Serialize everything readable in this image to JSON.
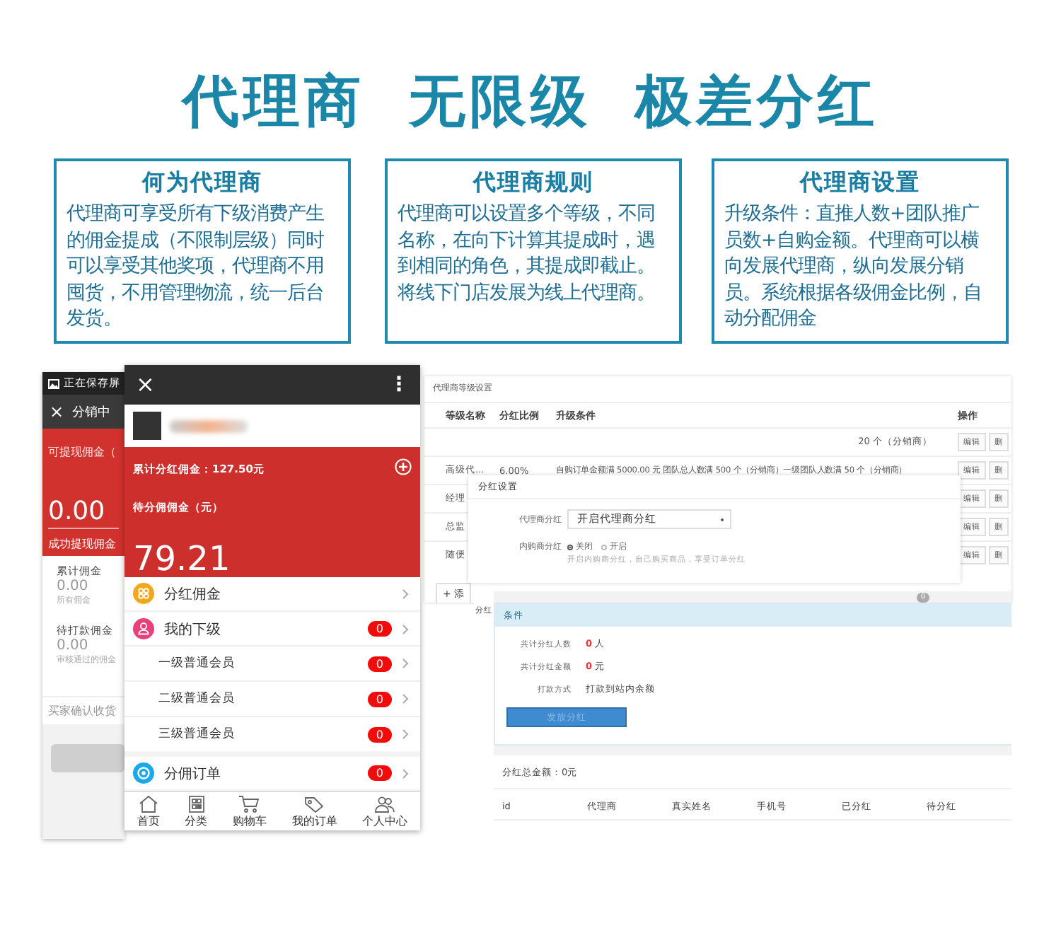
{
  "headline": "代理商 无限级 极差分红",
  "info_boxes": [
    {
      "title": "何为代理商",
      "body": "代理商可享受所有下级消费产生的佣金提成（不限制层级）同时可以享受其他奖项，代理商不用囤货，不用管理物流，统一后台发货。"
    },
    {
      "title": "代理商规则",
      "body": "代理商可以设置多个等级，不同名称，在向下计算其提成时，遇到相同的角色，其提成即截止。将线下门店发展为线上代理商。"
    },
    {
      "title": "代理商设置",
      "body": "升级条件：直推人数+团队推广员数+自购金额。代理商可以横向发展代理商，纵向发展分销员。系统根据各级佣金比例，自动分配佣金"
    }
  ],
  "phone_back": {
    "status": "正在保存屏",
    "close": "×",
    "title": "分销中",
    "withdrawable_label": "可提现佣金（",
    "withdrawable": "0.00",
    "withdrawn_label": "成功提现佣金",
    "stats": [
      {
        "label": "累计佣金",
        "value": "0.00",
        "note": "所有佣金"
      },
      {
        "label": "待打款佣金",
        "value": "0.00",
        "note": "审核通过的佣金"
      }
    ],
    "footer_note": "买家确认收货"
  },
  "phone_front": {
    "close": "×",
    "more": "⋮",
    "total_bonus": "累计分红佣金：127.50元",
    "pending_label": "待分佣佣金（元）",
    "pending": "79.21",
    "menu": [
      {
        "kind": "main",
        "label": "分红佣金"
      },
      {
        "kind": "main",
        "label": "我的下级",
        "badge": "0"
      },
      {
        "kind": "sub",
        "label": "一级普通会员",
        "badge": "0"
      },
      {
        "kind": "sub",
        "label": "二级普通会员",
        "badge": "0"
      },
      {
        "kind": "sub",
        "label": "三级普通会员",
        "badge": "0"
      },
      {
        "kind": "main",
        "label": "分佣订单",
        "badge": "0"
      }
    ],
    "nav": [
      {
        "label": "首页"
      },
      {
        "label": "分类"
      },
      {
        "label": "购物车"
      },
      {
        "label": "我的订单"
      },
      {
        "label": "个人中心"
      }
    ]
  },
  "admin": {
    "title": "代理商等级设置",
    "columns": [
      "等级名称",
      "分红比例",
      "升级条件",
      "操作"
    ],
    "rows": [
      {
        "condition": "20 个（分销商）",
        "actions": [
          "编辑",
          "删"
        ]
      },
      {
        "name": "高级代...",
        "ratio": "6.00%",
        "condition": "自购订单金额满 5000.00 元 团队总人数满 500 个（分销商）一级团队人数满 50 个（分销商）",
        "actions": [
          "编辑",
          "删"
        ]
      },
      {
        "name": "经理",
        "actions": [
          "编辑",
          "删"
        ]
      },
      {
        "name": "总监",
        "actions": [
          "编辑",
          "删"
        ]
      },
      {
        "name": "随便",
        "actions": [
          "编辑",
          "删"
        ]
      }
    ],
    "add_button": "+ 添"
  },
  "dialog": {
    "title": "分红设置",
    "agent_label": "代理商分红",
    "agent_value": "开启代理商分红",
    "inner_label": "内购商分红",
    "options": [
      {
        "label": "关闭",
        "selected": true
      },
      {
        "label": "开启",
        "selected": false
      }
    ],
    "hint": "开启内购商分红，自己购买商品，享受订单分红"
  },
  "payout": {
    "side_label": "分红",
    "notice_count": "0",
    "section": "条件",
    "fields": [
      {
        "kind": "count",
        "label": "共计分红人数",
        "value": "0",
        "unit": "人"
      },
      {
        "kind": "count",
        "label": "共计分红金额",
        "value": "0",
        "unit": "元"
      },
      {
        "kind": "text",
        "label": "打款方式",
        "value": "打款到站内余额"
      }
    ],
    "button": "发放分红",
    "total": "分红总金额：0元",
    "columns": [
      "id",
      "代理商",
      "真实姓名",
      "手机号",
      "已分红",
      "待分红"
    ]
  }
}
